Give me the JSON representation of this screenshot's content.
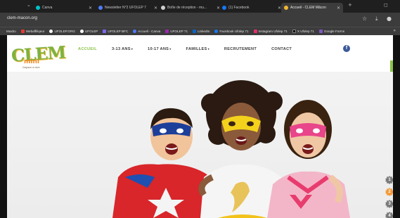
{
  "browser": {
    "tabs": [
      {
        "label": "Canva",
        "color": "#00c4cc"
      },
      {
        "label": "Newsletter N°2 UFOLEP 7",
        "color": "#4f7cff"
      },
      {
        "label": "Boîte de réception - mu...",
        "color": "#d0d0d0"
      },
      {
        "label": "(1) Facebook",
        "color": "#1877f2"
      },
      {
        "label": "Accueil - CLEM Mâcon",
        "color": "#f2b632"
      }
    ],
    "url": "clem-macon.org",
    "bookmarks": [
      {
        "label": "Webaffiliqeur",
        "color": "#e53935"
      },
      {
        "label": "UFOLEP.ORG",
        "color": "#ffffff"
      },
      {
        "label": "UFOLEP",
        "color": "#ffffff"
      },
      {
        "label": "UFOLEP BFC",
        "color": "#7b68ee"
      },
      {
        "label": "Accueil - Canva",
        "color": "#4f7cff"
      },
      {
        "label": "UFOLEP 71",
        "color": "#9c27b0"
      },
      {
        "label": "LinkedIn",
        "color": "#0a66c2"
      },
      {
        "label": "Facebook Ufolep 71",
        "color": "#1877f2"
      },
      {
        "label": "Instagram Ufolep 71",
        "color": "#e1306c"
      },
      {
        "label": "X Ufolep 71",
        "color": "#000000"
      },
      {
        "label": "Google Forms",
        "color": "#7e57c2"
      }
    ],
    "bookmark_prefix": "Maxbo"
  },
  "site": {
    "logo": {
      "word": "CLEM",
      "sub": "mini",
      "tagline": "l'espace à vivre"
    },
    "nav": [
      {
        "label": "ACCUEIL",
        "dropdown": false
      },
      {
        "label": "3-13 ANS",
        "dropdown": true
      },
      {
        "label": "10-17 ANS",
        "dropdown": true
      },
      {
        "label": "FAMILLES",
        "dropdown": true
      },
      {
        "label": "RECRUTEMENT",
        "dropdown": false
      },
      {
        "label": "CONTACT",
        "dropdown": false
      }
    ],
    "facebook_letter": "f",
    "slider": {
      "labels": [
        "1",
        "2",
        "3",
        "4"
      ],
      "active_index": 1
    },
    "colors": {
      "brand_green": "#8bc34a",
      "brand_orange": "#f39a3a",
      "facebook_blue": "#3b5998"
    }
  }
}
